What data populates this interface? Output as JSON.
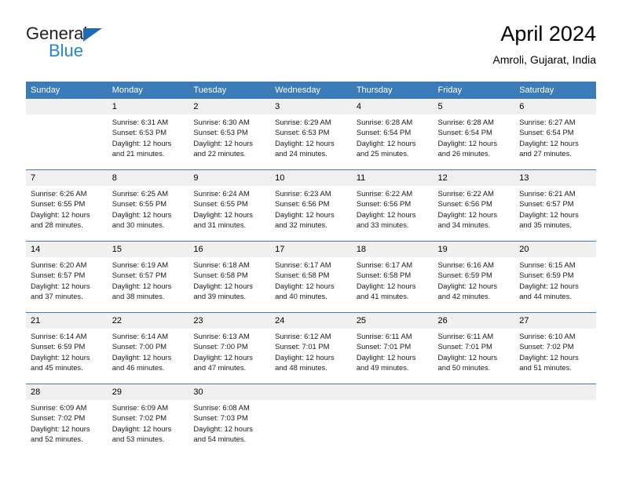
{
  "brand": {
    "name_top": "General",
    "name_bottom": "Blue",
    "triangle_color": "#1f6cb0",
    "blue_color": "#2585d3"
  },
  "header": {
    "title": "April 2024",
    "subtitle": "Amroli, Gujarat, India"
  },
  "theme": {
    "header_blue": "#3b7cb8",
    "daynum_band": "#f0f0f0",
    "text": "#000000"
  },
  "weekday_headers": [
    "Sunday",
    "Monday",
    "Tuesday",
    "Wednesday",
    "Thursday",
    "Friday",
    "Saturday"
  ],
  "weeks": [
    {
      "days": [
        {
          "num": "",
          "lines": []
        },
        {
          "num": "1",
          "lines": [
            "Sunrise: 6:31 AM",
            "Sunset: 6:53 PM",
            "Daylight: 12 hours",
            "and 21 minutes."
          ]
        },
        {
          "num": "2",
          "lines": [
            "Sunrise: 6:30 AM",
            "Sunset: 6:53 PM",
            "Daylight: 12 hours",
            "and 22 minutes."
          ]
        },
        {
          "num": "3",
          "lines": [
            "Sunrise: 6:29 AM",
            "Sunset: 6:53 PM",
            "Daylight: 12 hours",
            "and 24 minutes."
          ]
        },
        {
          "num": "4",
          "lines": [
            "Sunrise: 6:28 AM",
            "Sunset: 6:54 PM",
            "Daylight: 12 hours",
            "and 25 minutes."
          ]
        },
        {
          "num": "5",
          "lines": [
            "Sunrise: 6:28 AM",
            "Sunset: 6:54 PM",
            "Daylight: 12 hours",
            "and 26 minutes."
          ]
        },
        {
          "num": "6",
          "lines": [
            "Sunrise: 6:27 AM",
            "Sunset: 6:54 PM",
            "Daylight: 12 hours",
            "and 27 minutes."
          ]
        }
      ]
    },
    {
      "days": [
        {
          "num": "7",
          "lines": [
            "Sunrise: 6:26 AM",
            "Sunset: 6:55 PM",
            "Daylight: 12 hours",
            "and 28 minutes."
          ]
        },
        {
          "num": "8",
          "lines": [
            "Sunrise: 6:25 AM",
            "Sunset: 6:55 PM",
            "Daylight: 12 hours",
            "and 30 minutes."
          ]
        },
        {
          "num": "9",
          "lines": [
            "Sunrise: 6:24 AM",
            "Sunset: 6:55 PM",
            "Daylight: 12 hours",
            "and 31 minutes."
          ]
        },
        {
          "num": "10",
          "lines": [
            "Sunrise: 6:23 AM",
            "Sunset: 6:56 PM",
            "Daylight: 12 hours",
            "and 32 minutes."
          ]
        },
        {
          "num": "11",
          "lines": [
            "Sunrise: 6:22 AM",
            "Sunset: 6:56 PM",
            "Daylight: 12 hours",
            "and 33 minutes."
          ]
        },
        {
          "num": "12",
          "lines": [
            "Sunrise: 6:22 AM",
            "Sunset: 6:56 PM",
            "Daylight: 12 hours",
            "and 34 minutes."
          ]
        },
        {
          "num": "13",
          "lines": [
            "Sunrise: 6:21 AM",
            "Sunset: 6:57 PM",
            "Daylight: 12 hours",
            "and 35 minutes."
          ]
        }
      ]
    },
    {
      "days": [
        {
          "num": "14",
          "lines": [
            "Sunrise: 6:20 AM",
            "Sunset: 6:57 PM",
            "Daylight: 12 hours",
            "and 37 minutes."
          ]
        },
        {
          "num": "15",
          "lines": [
            "Sunrise: 6:19 AM",
            "Sunset: 6:57 PM",
            "Daylight: 12 hours",
            "and 38 minutes."
          ]
        },
        {
          "num": "16",
          "lines": [
            "Sunrise: 6:18 AM",
            "Sunset: 6:58 PM",
            "Daylight: 12 hours",
            "and 39 minutes."
          ]
        },
        {
          "num": "17",
          "lines": [
            "Sunrise: 6:17 AM",
            "Sunset: 6:58 PM",
            "Daylight: 12 hours",
            "and 40 minutes."
          ]
        },
        {
          "num": "18",
          "lines": [
            "Sunrise: 6:17 AM",
            "Sunset: 6:58 PM",
            "Daylight: 12 hours",
            "and 41 minutes."
          ]
        },
        {
          "num": "19",
          "lines": [
            "Sunrise: 6:16 AM",
            "Sunset: 6:59 PM",
            "Daylight: 12 hours",
            "and 42 minutes."
          ]
        },
        {
          "num": "20",
          "lines": [
            "Sunrise: 6:15 AM",
            "Sunset: 6:59 PM",
            "Daylight: 12 hours",
            "and 44 minutes."
          ]
        }
      ]
    },
    {
      "days": [
        {
          "num": "21",
          "lines": [
            "Sunrise: 6:14 AM",
            "Sunset: 6:59 PM",
            "Daylight: 12 hours",
            "and 45 minutes."
          ]
        },
        {
          "num": "22",
          "lines": [
            "Sunrise: 6:14 AM",
            "Sunset: 7:00 PM",
            "Daylight: 12 hours",
            "and 46 minutes."
          ]
        },
        {
          "num": "23",
          "lines": [
            "Sunrise: 6:13 AM",
            "Sunset: 7:00 PM",
            "Daylight: 12 hours",
            "and 47 minutes."
          ]
        },
        {
          "num": "24",
          "lines": [
            "Sunrise: 6:12 AM",
            "Sunset: 7:01 PM",
            "Daylight: 12 hours",
            "and 48 minutes."
          ]
        },
        {
          "num": "25",
          "lines": [
            "Sunrise: 6:11 AM",
            "Sunset: 7:01 PM",
            "Daylight: 12 hours",
            "and 49 minutes."
          ]
        },
        {
          "num": "26",
          "lines": [
            "Sunrise: 6:11 AM",
            "Sunset: 7:01 PM",
            "Daylight: 12 hours",
            "and 50 minutes."
          ]
        },
        {
          "num": "27",
          "lines": [
            "Sunrise: 6:10 AM",
            "Sunset: 7:02 PM",
            "Daylight: 12 hours",
            "and 51 minutes."
          ]
        }
      ]
    },
    {
      "days": [
        {
          "num": "28",
          "lines": [
            "Sunrise: 6:09 AM",
            "Sunset: 7:02 PM",
            "Daylight: 12 hours",
            "and 52 minutes."
          ]
        },
        {
          "num": "29",
          "lines": [
            "Sunrise: 6:09 AM",
            "Sunset: 7:02 PM",
            "Daylight: 12 hours",
            "and 53 minutes."
          ]
        },
        {
          "num": "30",
          "lines": [
            "Sunrise: 6:08 AM",
            "Sunset: 7:03 PM",
            "Daylight: 12 hours",
            "and 54 minutes."
          ]
        },
        {
          "num": "",
          "lines": []
        },
        {
          "num": "",
          "lines": []
        },
        {
          "num": "",
          "lines": []
        },
        {
          "num": "",
          "lines": []
        }
      ]
    }
  ]
}
